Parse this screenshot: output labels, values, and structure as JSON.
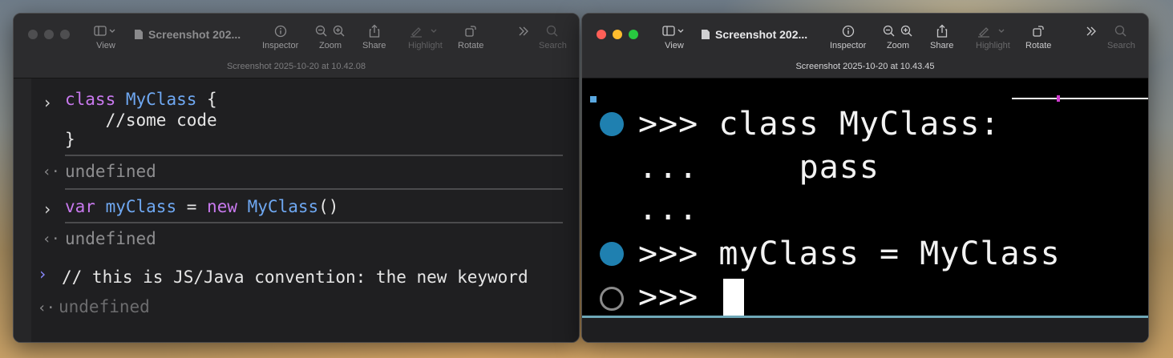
{
  "left_window": {
    "doc_title": "Screenshot 202...",
    "subtitle": "Screenshot 2025-10-20 at 10.42.08",
    "toolbar": {
      "view": "View",
      "inspector": "Inspector",
      "zoom": "Zoom",
      "share": "Share",
      "highlight": "Highlight",
      "rotate": "Rotate",
      "search": "Search"
    },
    "console": {
      "line1_kw": "class",
      "line1_cls": "MyClass",
      "line1_rest": " {",
      "line2": "    //some code",
      "line3": "}",
      "result1": "undefined",
      "line4_kw1": "var",
      "line4_var": "myClass",
      "line4_eq": " = ",
      "line4_kw2": "new",
      "line4_cls": "MyClass",
      "line4_rest": "()",
      "result2": "undefined",
      "line5": "// this is JS/Java convention: the new keyword",
      "result3": "undefined"
    }
  },
  "right_window": {
    "doc_title": "Screenshot 202...",
    "subtitle": "Screenshot 2025-10-20 at 10.43.45",
    "toolbar": {
      "view": "View",
      "inspector": "Inspector",
      "zoom": "Zoom",
      "share": "Share",
      "highlight": "Highlight",
      "rotate": "Rotate",
      "search": "Search"
    },
    "terminal": {
      "line1": ">>> class MyClass:",
      "line2": "...     pass",
      "line3": "...",
      "line4": ">>> myClass = MyClass",
      "line5": ">>>"
    }
  },
  "colors": {
    "keyword": "#c879ee",
    "class_name": "#6fa8f2",
    "prompt_dot": "#1f80b0"
  }
}
